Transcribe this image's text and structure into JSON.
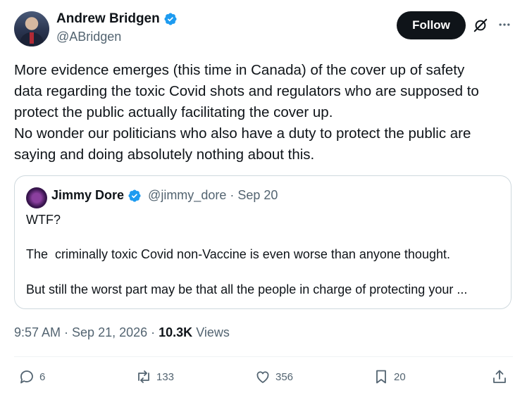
{
  "author": {
    "name": "Andrew Bridgen",
    "handle": "@ABridgen"
  },
  "follow_label": "Follow",
  "tweet_text": "More evidence emerges (this time in Canada) of the cover up of safety\ndata regarding the toxic Covid shots and regulators who are supposed to\nprotect the public actually facilitating the cover up.\nNo wonder our politicians who also have a duty to protect the public are\nsaying and doing absolutely nothing about this.",
  "quote": {
    "name": "Jimmy Dore",
    "handle": "@jimmy_dore",
    "date": "Sep 20",
    "line1": "WTF?",
    "line2": "The  criminally toxic Covid non-Vaccine is even worse than anyone thought.",
    "line3": "But still the worst part may be that all the people in charge of protecting your ..."
  },
  "timestamp": "9:57 AM · Sep 21, 2026 ·",
  "views": {
    "count": "10.3K",
    "label": "Views"
  },
  "actions": {
    "replies": "6",
    "reposts": "133",
    "likes": "356",
    "bookmarks": "20"
  },
  "colors": {
    "verified": "#1d9bf0",
    "secondary_text": "#536471",
    "primary_text": "#0f1419",
    "border": "#cfd9de"
  },
  "icons": [
    "verified-badge-icon",
    "grok-icon",
    "more-icon",
    "reply-icon",
    "repost-icon",
    "like-icon",
    "bookmark-icon",
    "share-icon"
  ]
}
